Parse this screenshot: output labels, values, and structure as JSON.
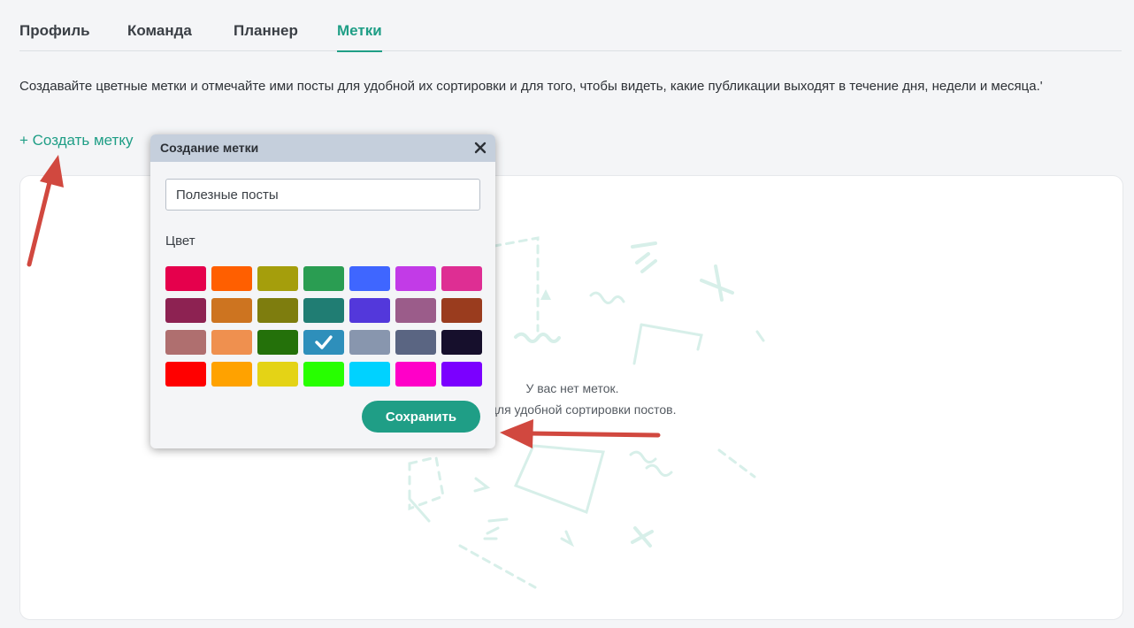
{
  "tabs": [
    {
      "label": "Профиль",
      "active": false
    },
    {
      "label": "Команда",
      "active": false
    },
    {
      "label": "Планнер",
      "active": false
    },
    {
      "label": "Метки",
      "active": true
    }
  ],
  "description": "Создавайте цветные метки и отмечайте ими посты для удобной их сортировки и для того, чтобы видеть, какие публикации выходят в течение дня, недели и месяца.'",
  "create_link": "+ Создать метку",
  "empty_state": {
    "title": "У вас нет меток.",
    "subtitle": "тки для удобной сортировки постов."
  },
  "modal": {
    "title": "Создание метки",
    "close_icon": "close-icon",
    "name_input_value": "Полезные посты",
    "color_label": "Цвет",
    "save_label": "Сохранить",
    "colors": [
      [
        "#e5004c",
        "#ff5f00",
        "#a59e0c",
        "#2a9d52",
        "#3f66ff",
        "#c23be7",
        "#de2e93"
      ],
      [
        "#8d2252",
        "#cd7420",
        "#7e7d0e",
        "#207d73",
        "#5338db",
        "#9b5c8a",
        "#9a3c1e"
      ],
      [
        "#af6f6f",
        "#ef904f",
        "#24710a",
        "#2e8fbb",
        "#8896ae",
        "#5a6582",
        "#160f2c"
      ],
      [
        "#ff0000",
        "#ffa200",
        "#e4d316",
        "#27ff00",
        "#00d2ff",
        "#ff00c8",
        "#7b00ff"
      ]
    ],
    "selected_color": "#2e8fbb",
    "selected_icon": "checkmark-icon"
  },
  "accent_color": "#1f9e86",
  "annotation_color": "#d1483f"
}
